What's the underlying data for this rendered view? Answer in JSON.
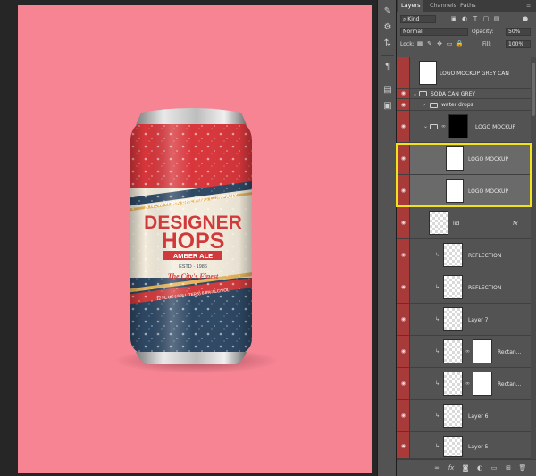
{
  "panel": {
    "tabs": [
      "Layers",
      "Channels",
      "Paths"
    ],
    "filter_kind": "Kind",
    "blend_mode": "Normal",
    "opacity_label": "Opacity:",
    "opacity_value": "50%",
    "lock_label": "Lock:",
    "fill_label": "Fill:",
    "fill_value": "100%"
  },
  "layers": [
    {
      "name": "LOGO MOCKUP GREY CAN",
      "kind": "smart",
      "visible": false
    },
    {
      "name": "SODA CAN GREY",
      "kind": "group",
      "visible": true
    },
    {
      "name": "water drops",
      "kind": "group",
      "visible": true
    },
    {
      "name": "LOGO MOCKUP",
      "kind": "masked",
      "visible": true
    },
    {
      "name": "LOGO MOCKUP",
      "kind": "smart",
      "visible": true,
      "selected": true
    },
    {
      "name": "LOGO MOCKUP",
      "kind": "smart",
      "visible": true,
      "selected": true
    },
    {
      "name": "lid",
      "kind": "smart-fx",
      "visible": true,
      "fx": "fx"
    },
    {
      "name": "REFLECTION",
      "kind": "clipped",
      "visible": true
    },
    {
      "name": "REFLECTION",
      "kind": "clipped",
      "visible": true
    },
    {
      "name": "Layer 7",
      "kind": "clipped",
      "visible": true
    },
    {
      "name": "Rectan...",
      "kind": "clipped-mask",
      "visible": true
    },
    {
      "name": "Rectan...",
      "kind": "clipped-mask",
      "visible": true
    },
    {
      "name": "Layer 6",
      "kind": "clipped",
      "visible": true
    },
    {
      "name": "Layer 5",
      "kind": "clipped",
      "visible": true
    }
  ],
  "can_label": {
    "top_line": "A NEW YORK BREWING COMPANY",
    "line1": "DESIGNER",
    "line2": "HOPS",
    "style": "AMBER ALE",
    "established": "ESTD · 1986",
    "tagline": "The City's Finest",
    "volume_line": "12 FL OZ (.355 LITERS) 6.8% ALC/VOL"
  },
  "colors": {
    "artboard": "#f78493",
    "can_red": "#d8363b",
    "can_navy": "#2e4864",
    "can_cream": "#f3ecdc",
    "label_red": "#d13a3c",
    "stripe_gold": "#e7b45a",
    "highlight": "#f1e31b",
    "eye_column": "#a83a3a"
  }
}
